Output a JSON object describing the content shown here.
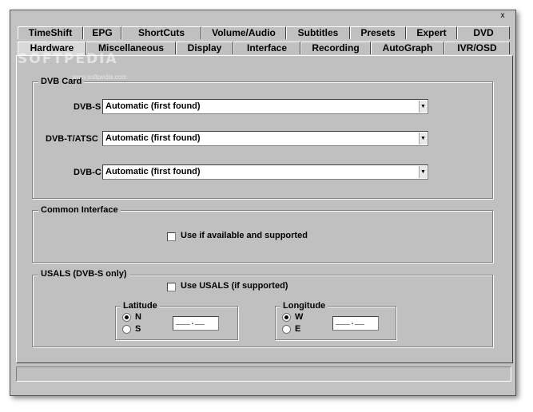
{
  "window": {
    "close_glyph": "x"
  },
  "tabs_row1": [
    "TimeShift",
    "EPG",
    "ShortCuts",
    "Volume/Audio",
    "Subtitles",
    "Presets",
    "Expert",
    "DVD"
  ],
  "tabs_row2": [
    "Hardware",
    "Miscellaneous",
    "Display",
    "Interface",
    "Recording",
    "AutoGraph",
    "IVR/OSD"
  ],
  "active_tab": "Hardware",
  "watermark": {
    "text": "SOFTPEDIA",
    "url": "www.softpedia.com"
  },
  "dvb_card": {
    "title": "DVB Card",
    "rows": [
      {
        "label": "DVB-S",
        "value": "Automatic (first found)"
      },
      {
        "label": "DVB-T/ATSC",
        "value": "Automatic (first found)"
      },
      {
        "label": "DVB-C",
        "value": "Automatic (first found)"
      }
    ]
  },
  "common_interface": {
    "title": "Common Interface",
    "checkbox_label": "Use if available and supported",
    "checked": false
  },
  "usals": {
    "title": "USALS (DVB-S only)",
    "checkbox_label": "Use USALS (if supported)",
    "checked": false,
    "latitude": {
      "title": "Latitude",
      "options": [
        "N",
        "S"
      ],
      "selected": "N",
      "value": "___.__"
    },
    "longitude": {
      "title": "Longitude",
      "options": [
        "W",
        "E"
      ],
      "selected": "W",
      "value": "___.__"
    }
  },
  "icons": {
    "dropdown": "dropdown-arrow-icon",
    "close": "close-icon"
  }
}
